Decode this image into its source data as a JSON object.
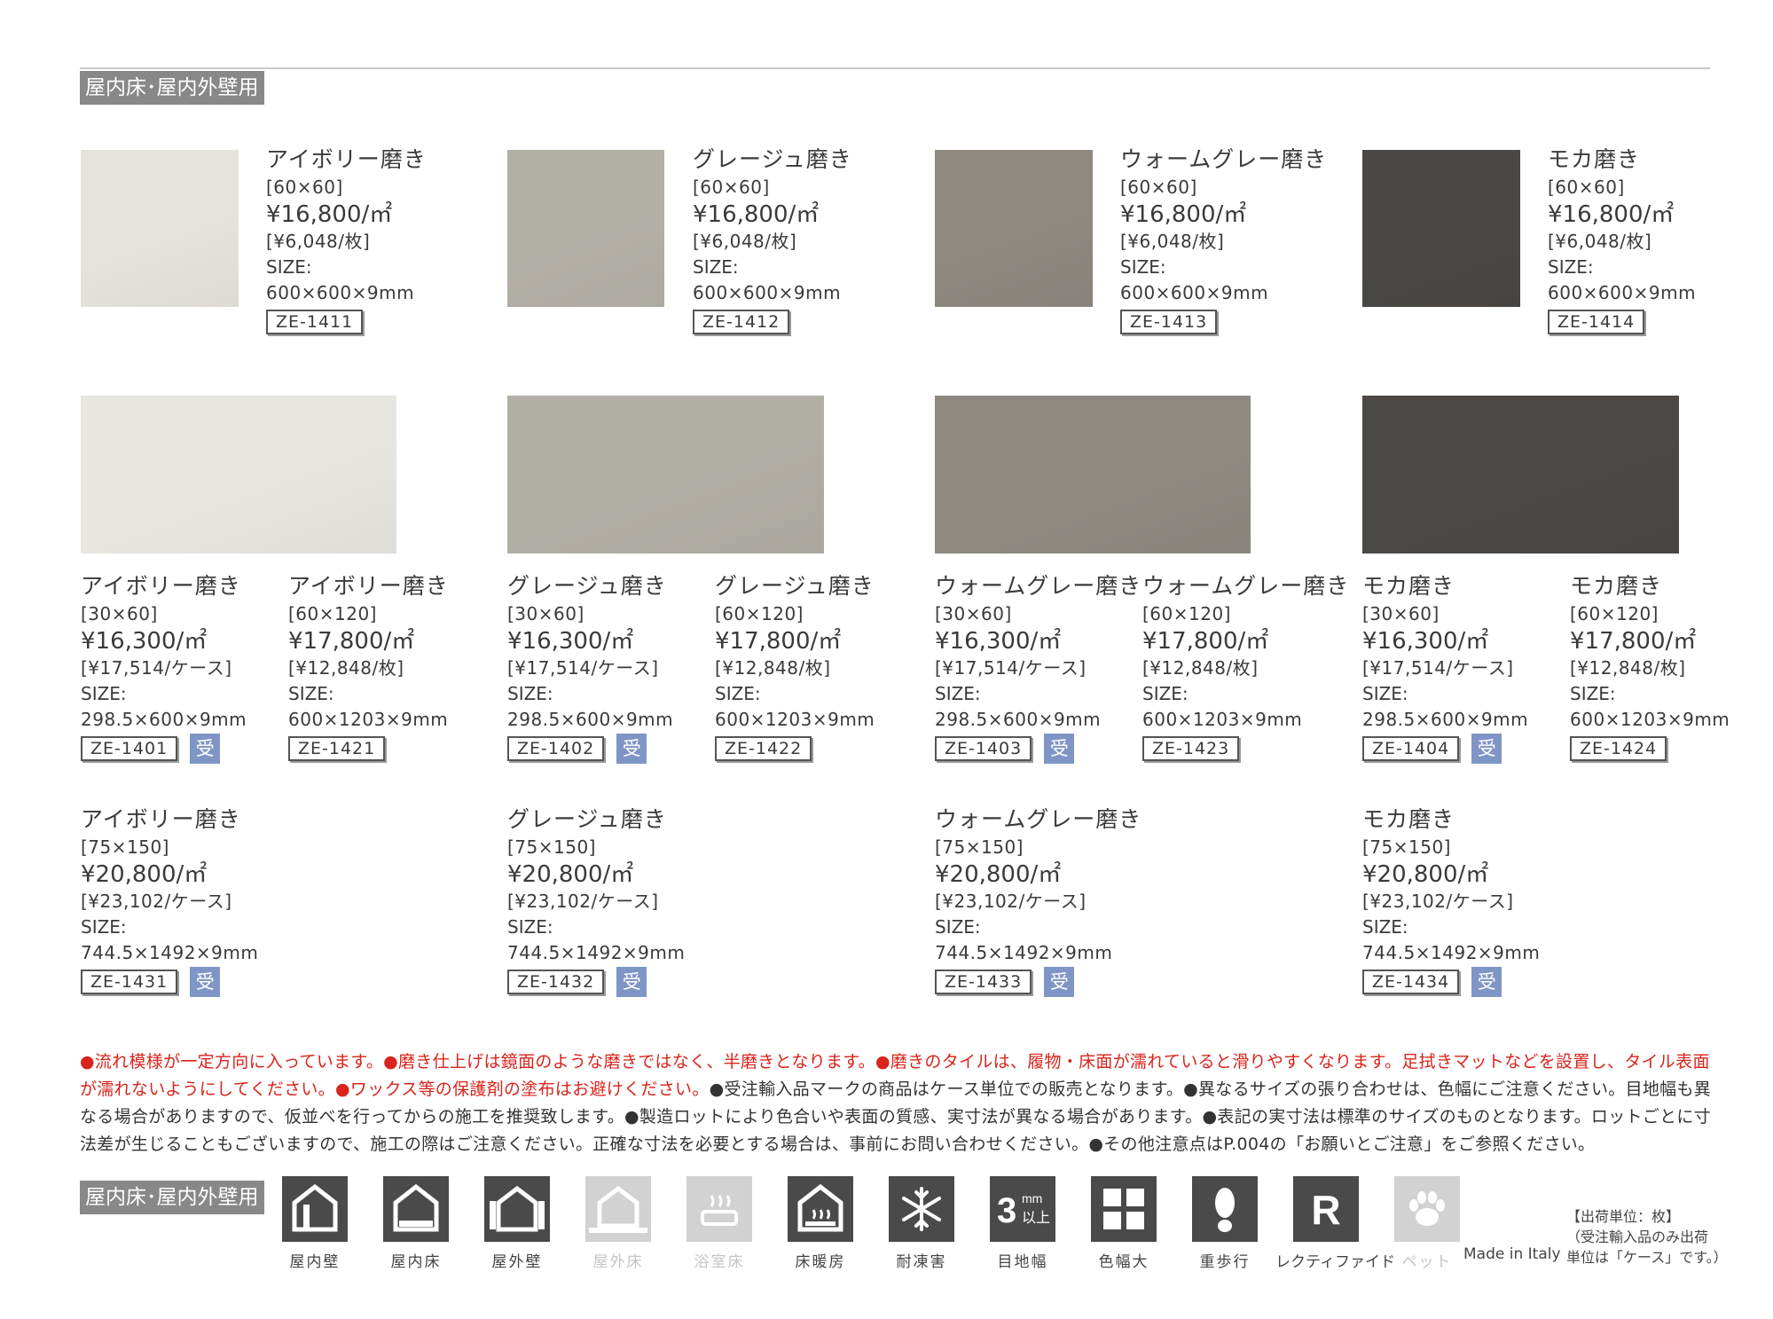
{
  "section_label": "屋内床･屋内外壁用",
  "row1": [
    {
      "name": "アイボリー磨き",
      "size_class": "[60×60]",
      "price": "¥16,800/㎡",
      "unit_price": "[¥6,048/枚]",
      "size_label": "SIZE:",
      "dims": "600×600×9mm",
      "code": "ZE-1411",
      "color": "#e5e3dc"
    },
    {
      "name": "グレージュ磨き",
      "size_class": "[60×60]",
      "price": "¥16,800/㎡",
      "unit_price": "[¥6,048/枚]",
      "size_label": "SIZE:",
      "dims": "600×600×9mm",
      "code": "ZE-1412",
      "color": "#b3b0a8"
    },
    {
      "name": "ウォームグレー磨き",
      "size_class": "[60×60]",
      "price": "¥16,800/㎡",
      "unit_price": "[¥6,048/枚]",
      "size_label": "SIZE:",
      "dims": "600×600×9mm",
      "code": "ZE-1413",
      "color": "#8d8981"
    },
    {
      "name": "モカ磨き",
      "size_class": "[60×60]",
      "price": "¥16,800/㎡",
      "unit_price": "[¥6,048/枚]",
      "size_label": "SIZE:",
      "dims": "600×600×9mm",
      "code": "ZE-1414",
      "color": "#4a4744"
    }
  ],
  "row2_swatches": [
    "#e8e6e0",
    "#b1aea6",
    "#8e8a82",
    "#4b4846"
  ],
  "row2": [
    {
      "name": "アイボリー磨き",
      "size_class": "[30×60]",
      "price": "¥16,300/㎡",
      "unit_price": "[¥17,514/ケース]",
      "size_label": "SIZE:",
      "dims": "298.5×600×9mm",
      "code": "ZE-1401",
      "badge": "受"
    },
    {
      "name": "アイボリー磨き",
      "size_class": "[60×120]",
      "price": "¥17,800/㎡",
      "unit_price": "[¥12,848/枚]",
      "size_label": "SIZE:",
      "dims": "600×1203×9mm",
      "code": "ZE-1421",
      "badge": ""
    },
    {
      "name": "グレージュ磨き",
      "size_class": "[30×60]",
      "price": "¥16,300/㎡",
      "unit_price": "[¥17,514/ケース]",
      "size_label": "SIZE:",
      "dims": "298.5×600×9mm",
      "code": "ZE-1402",
      "badge": "受"
    },
    {
      "name": "グレージュ磨き",
      "size_class": "[60×120]",
      "price": "¥17,800/㎡",
      "unit_price": "[¥12,848/枚]",
      "size_label": "SIZE:",
      "dims": "600×1203×9mm",
      "code": "ZE-1422",
      "badge": ""
    },
    {
      "name": "ウォームグレー磨き",
      "size_class": "[30×60]",
      "price": "¥16,300/㎡",
      "unit_price": "[¥17,514/ケース]",
      "size_label": "SIZE:",
      "dims": "298.5×600×9mm",
      "code": "ZE-1403",
      "badge": "受"
    },
    {
      "name": "ウォームグレー磨き",
      "size_class": "[60×120]",
      "price": "¥17,800/㎡",
      "unit_price": "[¥12,848/枚]",
      "size_label": "SIZE:",
      "dims": "600×1203×9mm",
      "code": "ZE-1423",
      "badge": ""
    },
    {
      "name": "モカ磨き",
      "size_class": "[30×60]",
      "price": "¥16,300/㎡",
      "unit_price": "[¥17,514/ケース]",
      "size_label": "SIZE:",
      "dims": "298.5×600×9mm",
      "code": "ZE-1404",
      "badge": "受"
    },
    {
      "name": "モカ磨き",
      "size_class": "[60×120]",
      "price": "¥17,800/㎡",
      "unit_price": "[¥12,848/枚]",
      "size_label": "SIZE:",
      "dims": "600×1203×9mm",
      "code": "ZE-1424",
      "badge": ""
    }
  ],
  "row3": [
    {
      "name": "アイボリー磨き",
      "size_class": "[75×150]",
      "price": "¥20,800/㎡",
      "unit_price": "[¥23,102/ケース]",
      "size_label": "SIZE:",
      "dims": "744.5×1492×9mm",
      "code": "ZE-1431",
      "badge": "受"
    },
    {
      "name": "グレージュ磨き",
      "size_class": "[75×150]",
      "price": "¥20,800/㎡",
      "unit_price": "[¥23,102/ケース]",
      "size_label": "SIZE:",
      "dims": "744.5×1492×9mm",
      "code": "ZE-1432",
      "badge": "受"
    },
    {
      "name": "ウォームグレー磨き",
      "size_class": "[75×150]",
      "price": "¥20,800/㎡",
      "unit_price": "[¥23,102/ケース]",
      "size_label": "SIZE:",
      "dims": "744.5×1492×9mm",
      "code": "ZE-1433",
      "badge": "受"
    },
    {
      "name": "モカ磨き",
      "size_class": "[75×150]",
      "price": "¥20,800/㎡",
      "unit_price": "[¥23,102/ケース]",
      "size_label": "SIZE:",
      "dims": "744.5×1492×9mm",
      "code": "ZE-1434",
      "badge": "受"
    }
  ],
  "notes": {
    "red1": "●流れ模様が一定方向に入っています。●磨き仕上げは鏡面のような磨きではなく、半磨きとなります。●磨きのタイルは、履物・床面が濡れていると滑りやすくなります。足拭きマットなどを設置し、タイル表面が濡れないようにしてください。●ワックス等の保護剤の塗布はお避けください。",
    "black": "●受注輸入品マークの商品はケース単位での販売となります。●異なるサイズの張り合わせは、色幅にご注意ください。目地幅も異なる場合がありますので、仮並べを行ってからの施工を推奨致します。●製造ロットにより色合いや表面の質感、実寸法が異なる場合があります。●表記の実寸法は標準のサイズのものとなります。ロットごとに寸法差が生じることもございますので、施工の際はご注意ください。正確な寸法を必要とする場合は、事前にお問い合わせください。●その他注意点はP.004の「お願いとご注意」をご参照ください。"
  },
  "icons": [
    {
      "label": "屋内壁",
      "icon": "indoor-wall-icon",
      "active": true
    },
    {
      "label": "屋内床",
      "icon": "indoor-floor-icon",
      "active": true
    },
    {
      "label": "屋外壁",
      "icon": "outdoor-wall-icon",
      "active": true
    },
    {
      "label": "屋外床",
      "icon": "outdoor-floor-icon",
      "active": false
    },
    {
      "label": "浴室床",
      "icon": "bathroom-floor-icon",
      "active": false
    },
    {
      "label": "床暖房",
      "icon": "floor-heating-icon",
      "active": true
    },
    {
      "label": "耐凍害",
      "icon": "frost-resistant-icon",
      "active": true
    },
    {
      "label": "目地幅",
      "icon": "joint-width-icon",
      "active": true,
      "text_main": "3",
      "text_sup": "mm",
      "text_sub": "以上"
    },
    {
      "label": "色幅大",
      "icon": "color-variation-icon",
      "active": true
    },
    {
      "label": "重歩行",
      "icon": "heavy-traffic-icon",
      "active": true
    },
    {
      "label": "レクティファイド",
      "icon": "rectified-icon",
      "active": true,
      "text_main": "R"
    },
    {
      "label": "ペット",
      "icon": "pet-icon",
      "active": false
    }
  ],
  "made_in": "Made in Italy",
  "shipping": [
    "【出荷単位：枚】",
    "（受注輸入品のみ出荷",
    "単位は「ケース」です。）"
  ]
}
